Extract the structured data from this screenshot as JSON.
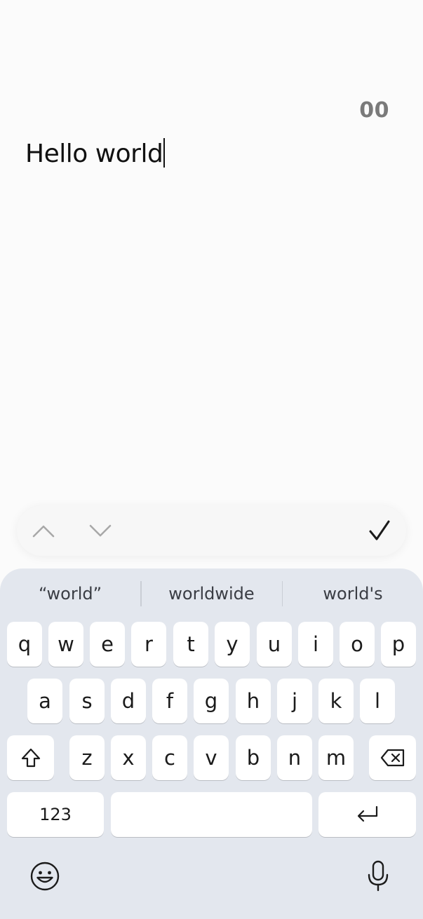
{
  "editor": {
    "char_count": "00",
    "text": "Hello world"
  },
  "find_toolbar": {
    "icons": {
      "up": "chevron-up-icon",
      "down": "chevron-down-icon",
      "confirm": "checkmark-icon"
    }
  },
  "keyboard": {
    "suggestions": [
      "“world”",
      "worldwide",
      "world's"
    ],
    "row1": [
      "q",
      "w",
      "e",
      "r",
      "t",
      "y",
      "u",
      "i",
      "o",
      "p"
    ],
    "row2": [
      "a",
      "s",
      "d",
      "f",
      "g",
      "h",
      "j",
      "k",
      "l"
    ],
    "row3": [
      "z",
      "x",
      "c",
      "v",
      "b",
      "n",
      "m"
    ],
    "numbers_label": "123",
    "space_label": "",
    "icons": {
      "shift": "shift-icon",
      "backspace": "backspace-icon",
      "enter": "return-icon",
      "emoji": "emoji-icon",
      "mic": "microphone-icon"
    },
    "colors": {
      "background": "#e3e7ee",
      "key": "#ffffff",
      "text": "#1b1b1b"
    }
  }
}
